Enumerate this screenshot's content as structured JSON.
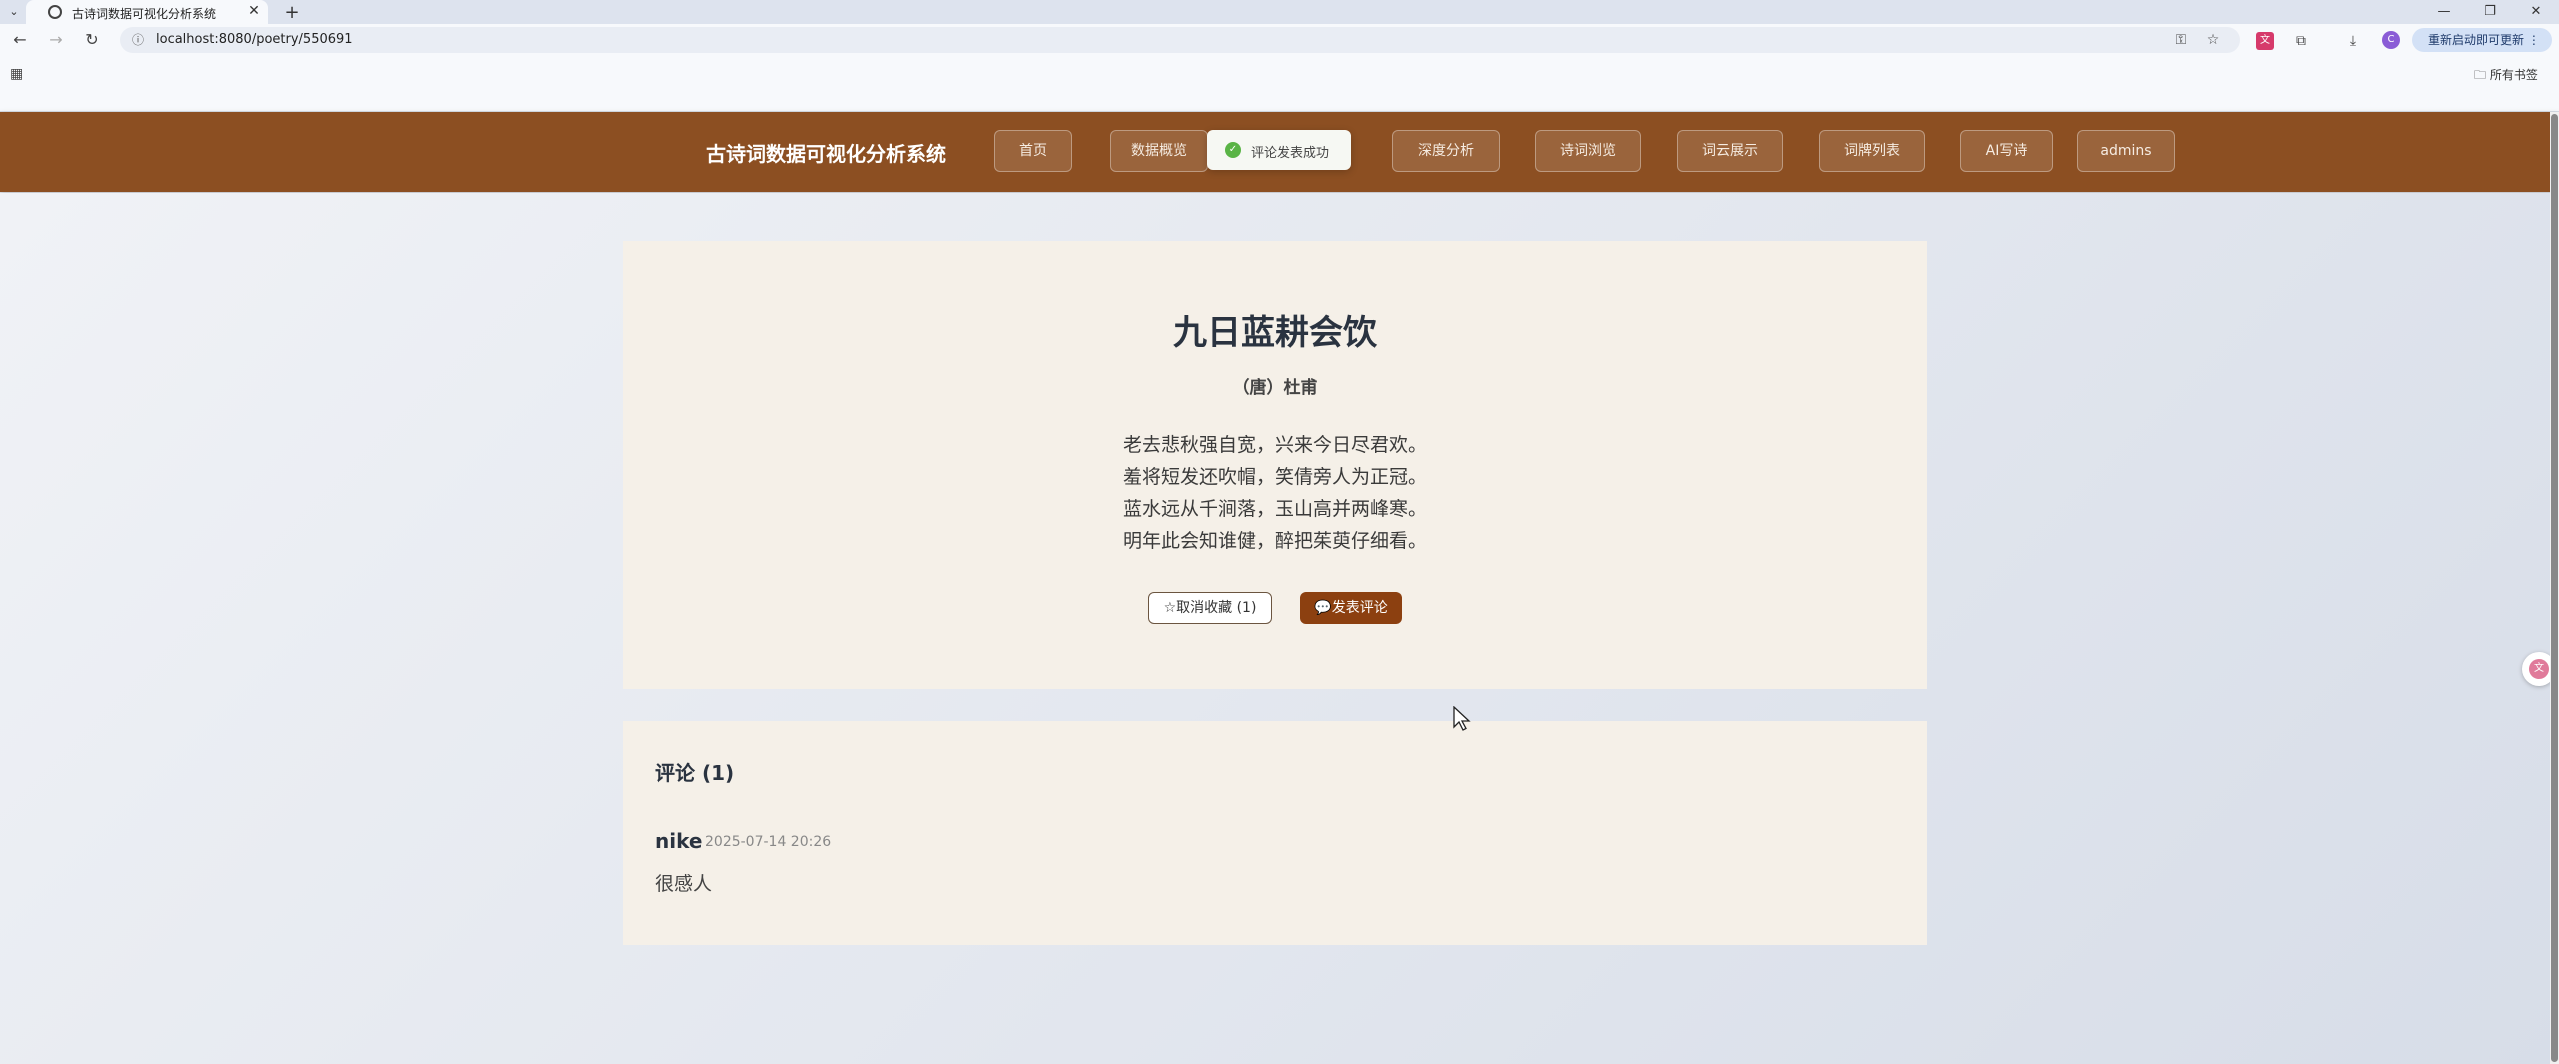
{
  "browser": {
    "tab_title": "古诗词数据可视化分析系统",
    "url": "localhost:8080/poetry/550691",
    "update_label": "重新启动即可更新",
    "all_bookmarks_label": "所有书签"
  },
  "header": {
    "site_title": "古诗词数据可视化分析系统",
    "nav": [
      {
        "label": "首页"
      },
      {
        "label": "数据概览"
      },
      {
        "label": "深度分析"
      },
      {
        "label": "诗词浏览"
      },
      {
        "label": "词云展示"
      },
      {
        "label": "词牌列表"
      },
      {
        "label": "AI写诗"
      },
      {
        "label": "admins"
      }
    ],
    "toast": "评论发表成功"
  },
  "poem": {
    "title": "九日蓝耕会饮",
    "author": "（唐）杜甫",
    "lines": [
      "老去悲秋强自宽，兴来今日尽君欢。",
      "羞将短发还吹帽，笑倩旁人为正冠。",
      "蓝水远从千涧落，玉山高并两峰寒。",
      "明年此会知谁健，醉把茱萸仔细看。"
    ],
    "fav_button": "☆取消收藏 (1)",
    "comment_button": "💬发表评论"
  },
  "comments": {
    "heading": "评论 (1)",
    "items": [
      {
        "user": "nike",
        "time": "2025-07-14 20:26",
        "text": "很感人"
      }
    ]
  }
}
